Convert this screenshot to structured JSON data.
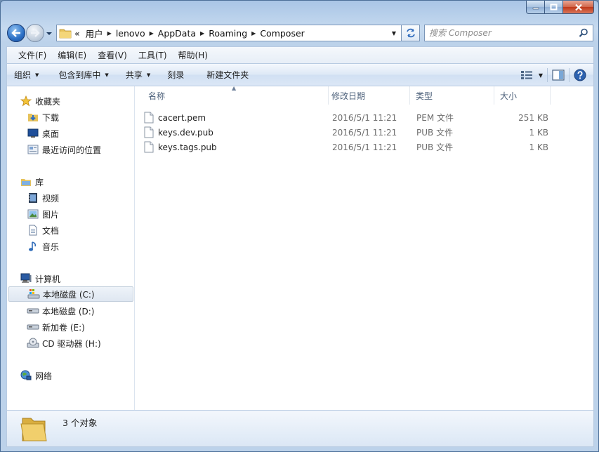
{
  "window": {
    "controls": {
      "minimize": "minimize",
      "maximize": "maximize",
      "close": "close"
    }
  },
  "address": {
    "crumbs": [
      "«",
      "用户",
      "lenovo",
      "AppData",
      "Roaming",
      "Composer"
    ]
  },
  "search": {
    "placeholder": "搜索 Composer"
  },
  "menu": [
    "文件(F)",
    "编辑(E)",
    "查看(V)",
    "工具(T)",
    "帮助(H)"
  ],
  "commands": {
    "organize": "组织",
    "include": "包含到库中",
    "share": "共享",
    "burn": "刻录",
    "new_folder": "新建文件夹"
  },
  "nav": {
    "favorites": {
      "label": "收藏夹",
      "items": [
        "下载",
        "桌面",
        "最近访问的位置"
      ]
    },
    "libraries": {
      "label": "库",
      "items": [
        "视频",
        "图片",
        "文档",
        "音乐"
      ]
    },
    "computer": {
      "label": "计算机",
      "items": [
        "本地磁盘 (C:)",
        "本地磁盘 (D:)",
        "新加卷 (E:)",
        "CD 驱动器 (H:)"
      ]
    },
    "network": {
      "label": "网络"
    }
  },
  "columns": {
    "name": "名称",
    "date": "修改日期",
    "type": "类型",
    "size": "大小"
  },
  "files": [
    {
      "name": "cacert.pem",
      "date": "2016/5/1 11:21",
      "type": "PEM 文件",
      "size": "251 KB"
    },
    {
      "name": "keys.dev.pub",
      "date": "2016/5/1 11:21",
      "type": "PUB 文件",
      "size": "1 KB"
    },
    {
      "name": "keys.tags.pub",
      "date": "2016/5/1 11:21",
      "type": "PUB 文件",
      "size": "1 KB"
    }
  ],
  "status": {
    "count": "3 个对象"
  }
}
